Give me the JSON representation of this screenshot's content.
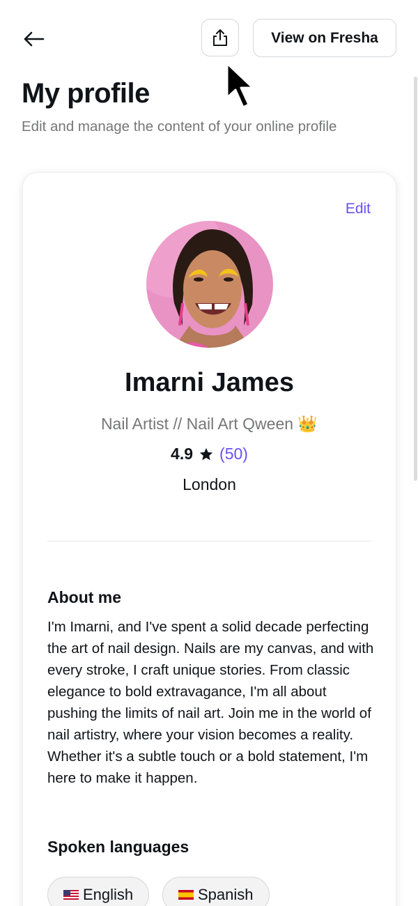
{
  "header": {
    "view_button_label": "View on Fresha"
  },
  "page": {
    "title": "My profile",
    "subtitle": "Edit and manage the content of your online profile"
  },
  "profile": {
    "edit_label": "Edit",
    "name": "Imarni James",
    "role": "Nail Artist // Nail Art Qween 👑",
    "rating": "4.9",
    "review_count": "(50)",
    "location": "London"
  },
  "about": {
    "heading": "About me",
    "text": "I'm Imarni, and I've spent a solid decade perfecting the art of nail design. Nails are my canvas, and with every stroke, I craft unique stories. From classic elegance to bold extravagance, I'm all about pushing the limits of nail art. Join me in the world of nail artistry, where your vision becomes a reality. Whether it's a subtle touch or a bold statement, I'm here to make it happen."
  },
  "languages": {
    "heading": "Spoken languages",
    "items": [
      {
        "label": "English",
        "flag_icon": "us-flag-icon"
      },
      {
        "label": "Spanish",
        "flag_icon": "spain-flag-icon"
      }
    ]
  },
  "colors": {
    "accent": "#6950f3",
    "text": "#101418",
    "muted": "#757676"
  }
}
